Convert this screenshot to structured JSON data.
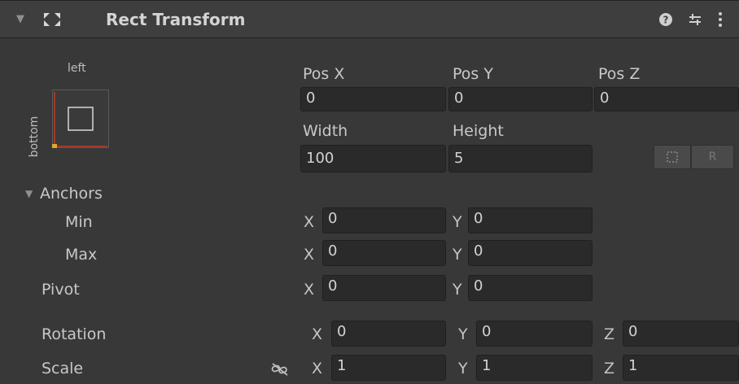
{
  "header": {
    "title": "Rect Transform"
  },
  "anchor_preset": {
    "top_label": "left",
    "side_label": "bottom"
  },
  "fields": {
    "pos_x": {
      "label": "Pos X",
      "value": "0"
    },
    "pos_y": {
      "label": "Pos Y",
      "value": "0"
    },
    "pos_z": {
      "label": "Pos Z",
      "value": "0"
    },
    "width": {
      "label": "Width",
      "value": "100"
    },
    "height": {
      "label": "Height",
      "value": "5"
    }
  },
  "blueprint_button": {
    "label": "R"
  },
  "anchors": {
    "label": "Anchors",
    "min": {
      "label": "Min",
      "x": "0",
      "y": "0"
    },
    "max": {
      "label": "Max",
      "x": "0",
      "y": "0"
    }
  },
  "pivot": {
    "label": "Pivot",
    "x": "0",
    "y": "0"
  },
  "rotation": {
    "label": "Rotation",
    "x": "0",
    "y": "0",
    "z": "0"
  },
  "scale": {
    "label": "Scale",
    "x": "1",
    "y": "1",
    "z": "1"
  },
  "axes": {
    "x": "X",
    "y": "Y",
    "z": "Z"
  },
  "icons": {
    "fold": "fold-triangle-icon",
    "component": "rect-transform-icon",
    "help": "help-icon",
    "presets": "presets-icon",
    "menu": "kebab-menu-icon",
    "constrain": "constrain-proportions-icon",
    "blueprint": "blueprint-mode-icon"
  },
  "colors": {
    "background": "#383838",
    "header": "#3e3e3e",
    "field": "#2a2a2a",
    "anchor_red": "#c0392b",
    "pivot_yellow": "#e0a82e"
  }
}
